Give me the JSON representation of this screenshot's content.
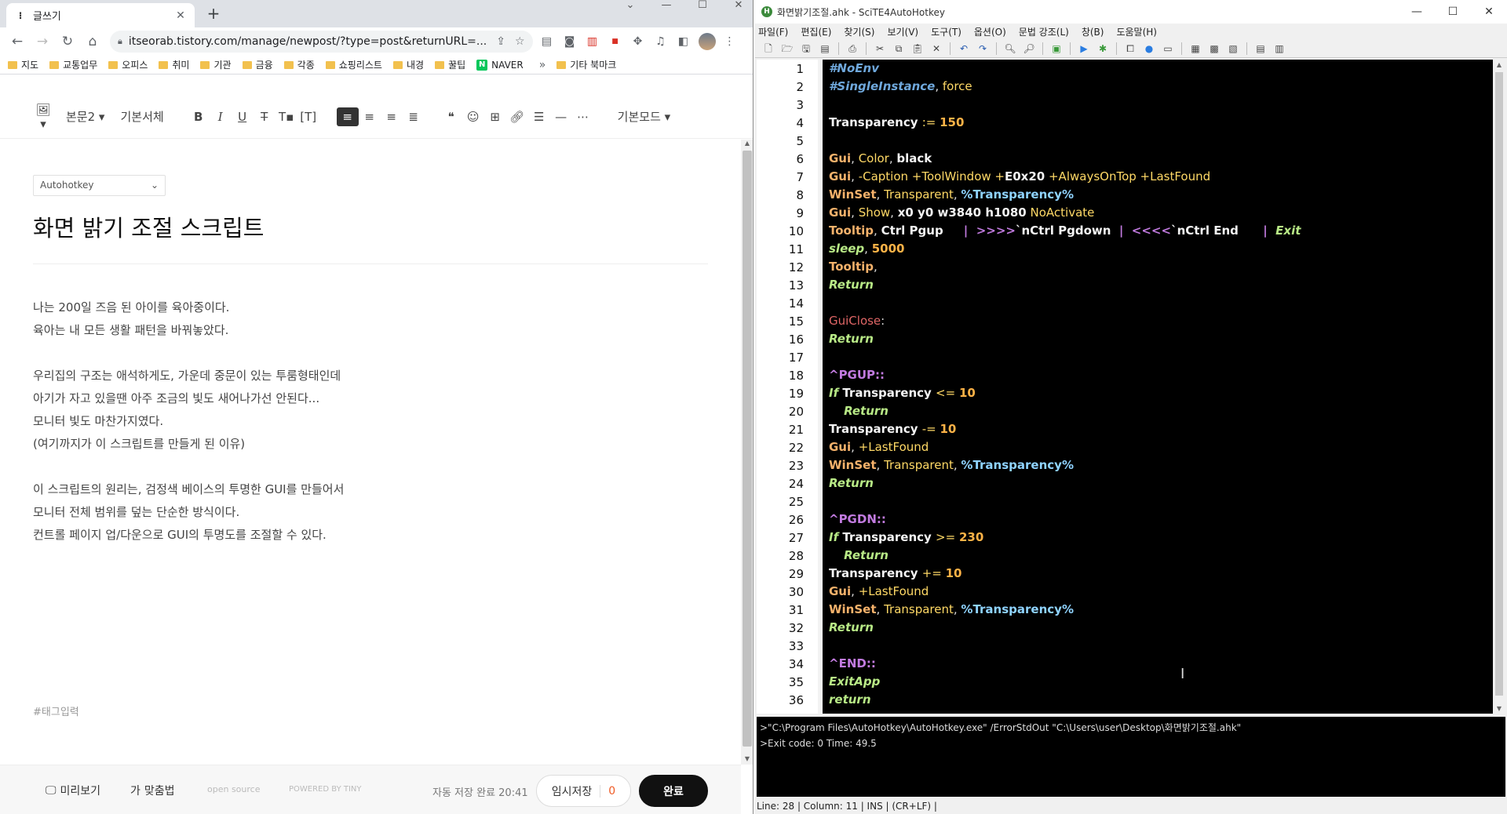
{
  "browser": {
    "tab_title": "글쓰기",
    "url": "itseorab.tistory.com/manage/newpost/?type=post&returnURL=...",
    "bookmarks": [
      "지도",
      "교통업무",
      "오피스",
      "취미",
      "기관",
      "금융",
      "각종",
      "쇼핑리스트",
      "내경",
      "꿀팁",
      "NAVER"
    ],
    "other_bookmarks": "기타 북마크"
  },
  "editor_toolbar": {
    "paragraph": "본문2",
    "font": "기본서체",
    "mode": "기본모드"
  },
  "post": {
    "category": "Autohotkey",
    "title": "화면 밝기 조절 스크립트",
    "paragraphs": [
      "나는 200일 즈음 된 아이를 육아중이다.",
      "육아는 내 모든 생활 패턴을 바꿔놓았다.",
      "",
      "우리집의 구조는 애석하게도, 가운데 중문이 있는 투룸형태인데",
      "아기가 자고 있을땐 아주 조금의 빛도 새어나가선 안된다...",
      "모니터 빛도 마찬가지였다.",
      "(여기까지가 이 스크립트를 만들게 된 이유)",
      "",
      "이 스크립트의 원리는, 검정색 베이스의 투명한 GUI를 만들어서",
      "모니터 전체 범위를 덮는 단순한 방식이다.",
      "컨트롤 페이지 업/다운으로 GUI의 투명도를 조절할 수 있다."
    ],
    "tag_placeholder": "#태그입력"
  },
  "footer": {
    "preview": "미리보기",
    "spellcheck": "맞춤법",
    "open_source": "open source",
    "powered_by": "POWERED BY TINY",
    "autosave": "자동 저장 완료 20:41",
    "temp_save": "임시저장",
    "temp_count": "0",
    "done": "완료"
  },
  "scite": {
    "title": "화면밝기조절.ahk - SciTE4AutoHotkey",
    "menu": [
      "파일(F)",
      "편집(E)",
      "찾기(S)",
      "보기(V)",
      "도구(T)",
      "옵션(O)",
      "문법 강조(L)",
      "창(B)",
      "도움말(H)"
    ],
    "output_lines": [
      ">\"C:\\Program Files\\AutoHotkey\\AutoHotkey.exe\" /ErrorStdOut \"C:\\Users\\user\\Desktop\\화면밝기조절.ahk\"",
      ">Exit code: 0    Time: 49.5"
    ],
    "status": "Line: 28 | Column: 11 | INS | (CR+LF) |",
    "code": [
      [
        [
          "k-dir",
          "#NoEnv"
        ]
      ],
      [
        [
          "k-dir",
          "#SingleInstance"
        ],
        [
          "k-punct",
          ", "
        ],
        [
          "k-opt",
          "force"
        ]
      ],
      [],
      [
        [
          "k-name",
          "Transparency "
        ],
        [
          "k-op",
          ":= "
        ],
        [
          "k-num",
          "150"
        ]
      ],
      [],
      [
        [
          "k-cmd",
          "Gui"
        ],
        [
          "k-punct",
          ", "
        ],
        [
          "k-opt",
          "Color"
        ],
        [
          "k-punct",
          ", "
        ],
        [
          "k-name",
          "black"
        ]
      ],
      [
        [
          "k-cmd",
          "Gui"
        ],
        [
          "k-punct",
          ", "
        ],
        [
          "k-opt",
          "-Caption +ToolWindow +"
        ],
        [
          "k-name",
          "E0x20"
        ],
        [
          "k-opt",
          " +AlwaysOnTop +LastFound"
        ]
      ],
      [
        [
          "k-cmd",
          "WinSet"
        ],
        [
          "k-punct",
          ", "
        ],
        [
          "k-opt",
          "Transparent"
        ],
        [
          "k-punct",
          ", "
        ],
        [
          "k-var",
          "%Transparency%"
        ]
      ],
      [
        [
          "k-cmd",
          "Gui"
        ],
        [
          "k-punct",
          ", "
        ],
        [
          "k-opt",
          "Show"
        ],
        [
          "k-punct",
          ", "
        ],
        [
          "k-name",
          "x0 y0 w3840 h1080"
        ],
        [
          "k-opt",
          " NoActivate"
        ]
      ],
      [
        [
          "k-cmd",
          "Tooltip"
        ],
        [
          "k-punct",
          ", "
        ],
        [
          "k-name",
          "Ctrl Pgup     "
        ],
        [
          "k-pipe",
          "|  >>>>"
        ],
        [
          "k-name",
          "`nCtrl Pgdown  "
        ],
        [
          "k-pipe",
          "|  <<<<"
        ],
        [
          "k-name",
          "`nCtrl End      "
        ],
        [
          "k-pipe",
          "|  "
        ],
        [
          "k-flow",
          "Exit"
        ]
      ],
      [
        [
          "k-flow",
          "sleep"
        ],
        [
          "k-punct",
          ", "
        ],
        [
          "k-num",
          "5000"
        ]
      ],
      [
        [
          "k-cmd",
          "Tooltip"
        ],
        [
          "k-punct",
          ","
        ]
      ],
      [
        [
          "k-flow",
          "Return"
        ]
      ],
      [],
      [
        [
          "k-label",
          "GuiClose"
        ],
        [
          "k-punct",
          ":"
        ]
      ],
      [
        [
          "k-flow",
          "Return"
        ]
      ],
      [],
      [
        [
          "k-hot",
          "^PGUP::"
        ]
      ],
      [
        [
          "k-flow",
          "If"
        ],
        [
          "k-name",
          " Transparency "
        ],
        [
          "k-op",
          "<= "
        ],
        [
          "k-num",
          "10"
        ]
      ],
      [
        [
          "k-punct",
          "    "
        ],
        [
          "k-flow",
          "Return"
        ]
      ],
      [
        [
          "k-name",
          "Transparency "
        ],
        [
          "k-op",
          "-= "
        ],
        [
          "k-num",
          "10"
        ]
      ],
      [
        [
          "k-cmd",
          "Gui"
        ],
        [
          "k-punct",
          ", "
        ],
        [
          "k-opt",
          "+LastFound"
        ]
      ],
      [
        [
          "k-cmd",
          "WinSet"
        ],
        [
          "k-punct",
          ", "
        ],
        [
          "k-opt",
          "Transparent"
        ],
        [
          "k-punct",
          ", "
        ],
        [
          "k-var",
          "%Transparency%"
        ]
      ],
      [
        [
          "k-flow",
          "Return"
        ]
      ],
      [],
      [
        [
          "k-hot",
          "^PGDN::"
        ]
      ],
      [
        [
          "k-flow",
          "If"
        ],
        [
          "k-name",
          " Transparency "
        ],
        [
          "k-op",
          ">= "
        ],
        [
          "k-num",
          "230"
        ]
      ],
      [
        [
          "k-punct",
          "    "
        ],
        [
          "k-flow",
          "Return"
        ]
      ],
      [
        [
          "k-name",
          "Transparency "
        ],
        [
          "k-op",
          "+= "
        ],
        [
          "k-num",
          "10"
        ]
      ],
      [
        [
          "k-cmd",
          "Gui"
        ],
        [
          "k-punct",
          ", "
        ],
        [
          "k-opt",
          "+LastFound"
        ]
      ],
      [
        [
          "k-cmd",
          "WinSet"
        ],
        [
          "k-punct",
          ", "
        ],
        [
          "k-opt",
          "Transparent"
        ],
        [
          "k-punct",
          ", "
        ],
        [
          "k-var",
          "%Transparency%"
        ]
      ],
      [
        [
          "k-flow",
          "Return"
        ]
      ],
      [],
      [
        [
          "k-hot",
          "^END::"
        ]
      ],
      [
        [
          "k-flow",
          "ExitApp"
        ]
      ],
      [
        [
          "k-flow",
          "return"
        ]
      ]
    ]
  },
  "colors": {
    "editor_bg": "#000000",
    "done_button": "#111111",
    "temp_count": "#ef5b25",
    "naver_green": "#03c75a"
  }
}
